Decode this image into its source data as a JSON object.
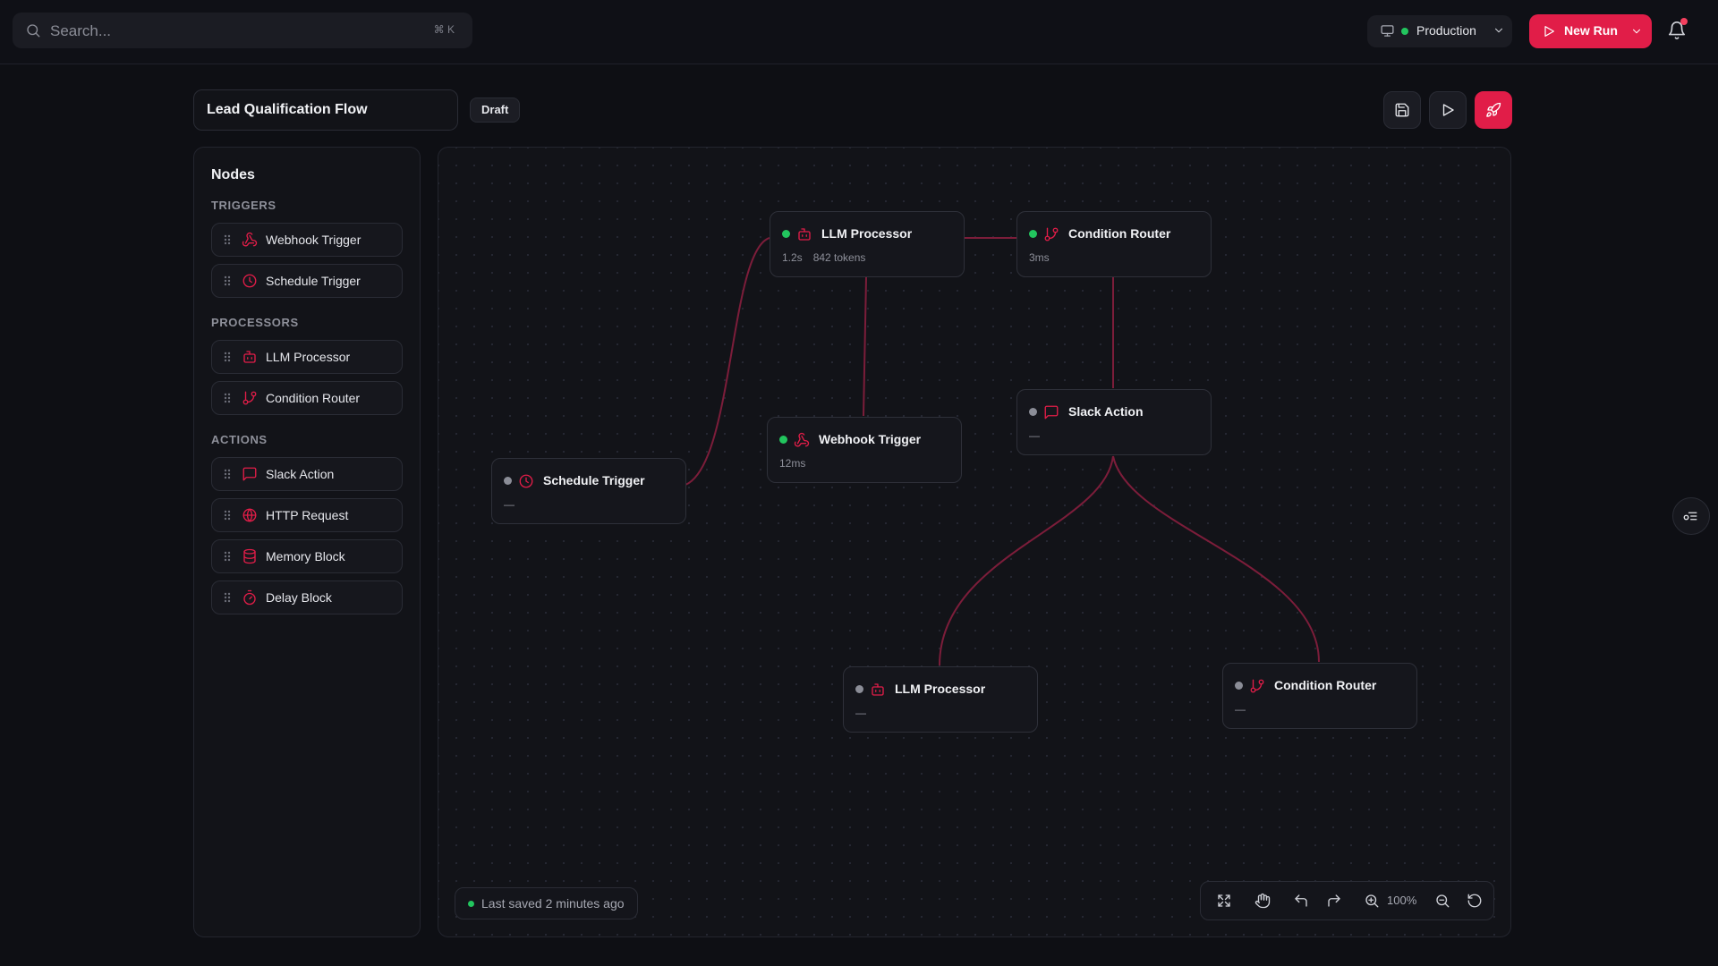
{
  "search": {
    "placeholder": "Search...",
    "shortcut": "⌘ K"
  },
  "environment": {
    "label": "Production",
    "status_color": "#22c55e"
  },
  "new_run": {
    "label": "New Run"
  },
  "flow": {
    "title": "Lead Qualification Flow",
    "status": "Draft"
  },
  "sidebar": {
    "title": "Nodes",
    "sections": [
      {
        "label": "TRIGGERS",
        "items": [
          {
            "label": "Webhook Trigger",
            "icon": "webhook-icon"
          },
          {
            "label": "Schedule Trigger",
            "icon": "clock-icon"
          }
        ]
      },
      {
        "label": "PROCESSORS",
        "items": [
          {
            "label": "LLM Processor",
            "icon": "bot-icon"
          },
          {
            "label": "Condition Router",
            "icon": "git-branch-icon"
          }
        ]
      },
      {
        "label": "ACTIONS",
        "items": [
          {
            "label": "Slack Action",
            "icon": "message-icon"
          },
          {
            "label": "HTTP Request",
            "icon": "globe-icon"
          },
          {
            "label": "Memory Block",
            "icon": "database-icon"
          },
          {
            "label": "Delay Block",
            "icon": "timer-icon"
          }
        ]
      }
    ]
  },
  "canvas": {
    "nodes": [
      {
        "title": "LLM Processor",
        "status": "active",
        "meta": [
          "1.2s",
          "842 tokens"
        ]
      },
      {
        "title": "Condition Router",
        "status": "active",
        "meta": [
          "3ms"
        ]
      },
      {
        "title": "Slack Action",
        "status": "idle",
        "meta": [
          "—"
        ]
      },
      {
        "title": "Webhook Trigger",
        "status": "active",
        "meta": [
          "12ms"
        ]
      },
      {
        "title": "Schedule Trigger",
        "status": "idle",
        "meta": [
          "—"
        ]
      },
      {
        "title": "LLM Processor",
        "status": "idle",
        "meta": [
          "—"
        ]
      },
      {
        "title": "Condition Router",
        "status": "idle",
        "meta": [
          "—"
        ]
      }
    ],
    "last_saved": "Last saved 2 minutes ago",
    "zoom": "100%"
  },
  "colors": {
    "accent": "#e11d48",
    "active": "#22c55e",
    "idle": "#8b8d97",
    "edge": "#7c1d3a"
  }
}
